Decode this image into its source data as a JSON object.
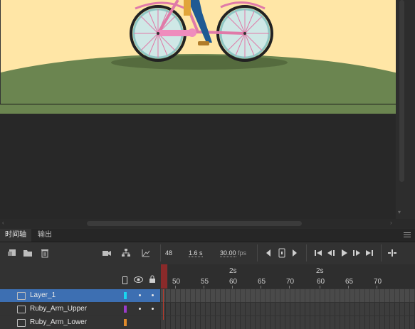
{
  "panel": {
    "tabs": [
      {
        "label": "时间轴",
        "active": true
      },
      {
        "label": "输出",
        "active": false
      }
    ]
  },
  "toolbar": {
    "current_frame": "48",
    "current_time": "1.6 s",
    "fps_value": "30.00",
    "fps_unit": "fps",
    "icons": [
      "new-layer-icon",
      "new-folder-icon",
      "delete-icon",
      "camera-icon",
      "layer-parenting-icon",
      "graph-icon",
      "prev-keyframe-icon",
      "add-keyframe-icon",
      "next-keyframe-icon",
      "go-to-first-icon",
      "step-back-icon",
      "play-icon",
      "step-forward-icon",
      "go-to-last-icon",
      "center-frame-icon"
    ]
  },
  "ruler": {
    "frame_labels": [
      "50",
      "55",
      "60",
      "65",
      "70",
      "60",
      "65",
      "70"
    ],
    "second_labels": [
      "2s",
      "2s"
    ]
  },
  "layers": [
    {
      "name": "Layer_1",
      "color": "#19d4f0",
      "selected": true
    },
    {
      "name": "Ruby_Arm_Upper",
      "color": "#9a3bc9",
      "selected": false
    },
    {
      "name": "Ruby_Arm_Lower",
      "color": "#e08a2b",
      "selected": false
    }
  ],
  "colors": {
    "accent_selected": "#3d6fb2",
    "playhead": "#c0392b",
    "ground": "#6b8550",
    "sky": "#ffe6a6"
  }
}
